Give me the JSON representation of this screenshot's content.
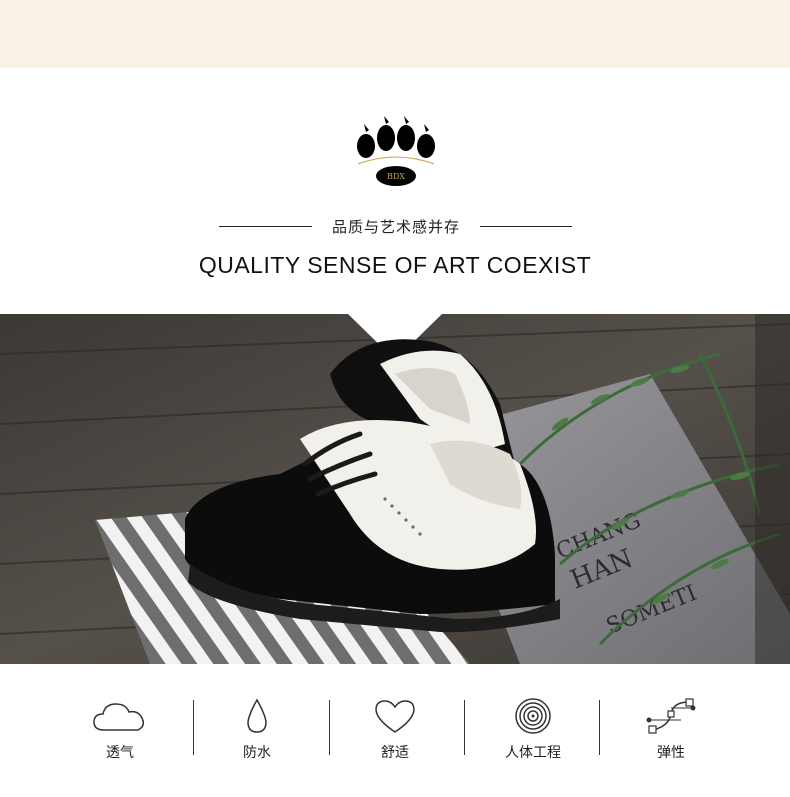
{
  "header": {
    "brand_text": "BDX",
    "subtitle": "品质与艺术感并存",
    "headline": "QUALITY SENSE OF ART COEXIST"
  },
  "photo": {
    "backdrop_text_1": "CHANG",
    "backdrop_text_2": "SOMETI",
    "backdrop_text_3": "HAN",
    "colors": {
      "wood": "#4a4642",
      "paper": "#8a8a8e",
      "shoe_black": "#0c0c0c",
      "shoe_white": "#f2f0ea",
      "leaf": "#3d6a3a"
    }
  },
  "features": [
    {
      "icon": "cloud-icon",
      "label": "透气"
    },
    {
      "icon": "water-drop-icon",
      "label": "防水"
    },
    {
      "icon": "heart-icon",
      "label": "舒适"
    },
    {
      "icon": "fingerprint-icon",
      "label": "人体工程"
    },
    {
      "icon": "bezier-curve-icon",
      "label": "弹性"
    }
  ],
  "colors": {
    "top_band": "#f8f2e6",
    "text": "#222222",
    "logo_gold": "#c9a24a"
  }
}
